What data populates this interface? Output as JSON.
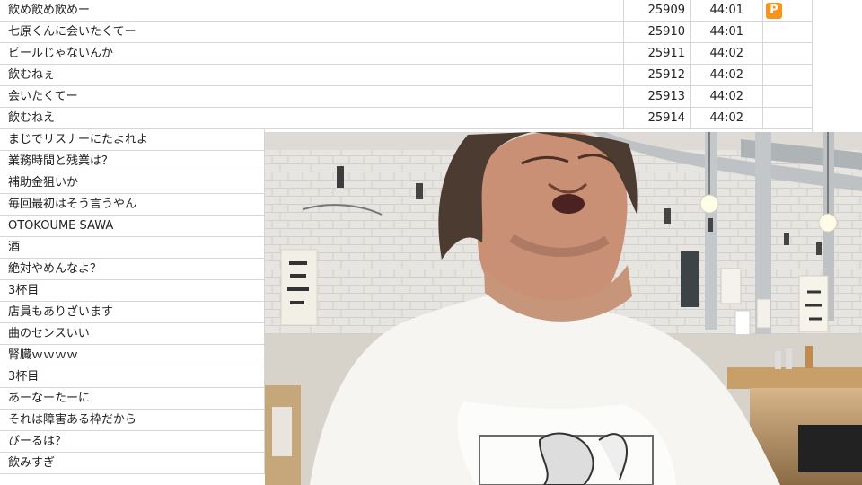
{
  "comments": [
    {
      "text": "飲め飲め飲めー",
      "number": "25909",
      "time": "44:01",
      "badge": "P"
    },
    {
      "text": "七原くんに会いたくてー",
      "number": "25910",
      "time": "44:01",
      "badge": ""
    },
    {
      "text": "ビールじゃないんか",
      "number": "25911",
      "time": "44:02",
      "badge": ""
    },
    {
      "text": "飲むねぇ",
      "number": "25912",
      "time": "44:02",
      "badge": ""
    },
    {
      "text": "会いたくてー",
      "number": "25913",
      "time": "44:02",
      "badge": ""
    },
    {
      "text": "飲むねえ",
      "number": "25914",
      "time": "44:02",
      "badge": ""
    },
    {
      "text": "まじでリスナーにたよれよ"
    },
    {
      "text": "業務時間と残業は？"
    },
    {
      "text": "補助金狙いか"
    },
    {
      "text": "毎回最初はそう言うやん"
    },
    {
      "text": "OTOKOUME SAWA"
    },
    {
      "text": "酒"
    },
    {
      "text": "絶対やめんなよ？"
    },
    {
      "text": "3杯目"
    },
    {
      "text": "店員もありざいます"
    },
    {
      "text": "曲のセンスいい"
    },
    {
      "text": "腎臓ｗｗｗｗ"
    },
    {
      "text": "3杯目"
    },
    {
      "text": "あーなーたーに"
    },
    {
      "text": "それは障害ある枠だから"
    },
    {
      "text": "びーるは？"
    },
    {
      "text": "飲みすぎ"
    }
  ],
  "colors": {
    "premium_badge": "#f7941d",
    "grid_lines": "#d6d6d6"
  },
  "icons": {
    "premium": "premium-p-icon"
  }
}
